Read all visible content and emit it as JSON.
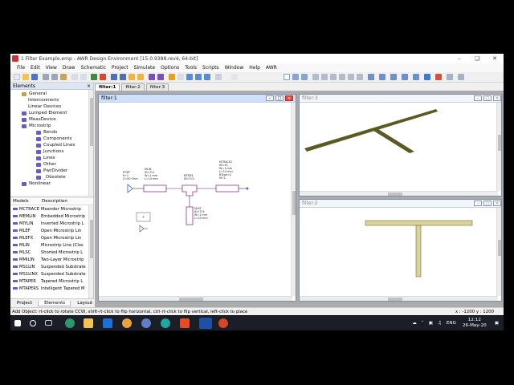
{
  "window": {
    "title": "1 Filter Example.emp - AWR Design Environment [15.0.9388.rev4, 64-bit]"
  },
  "menu": [
    "File",
    "Edit",
    "View",
    "Draw",
    "Schematic",
    "Project",
    "Simulate",
    "Options",
    "Tools",
    "Scripts",
    "Window",
    "Help",
    "AWR"
  ],
  "elements_panel": {
    "title": "Elements",
    "tree": [
      {
        "label": "General",
        "level": 1
      },
      {
        "label": "Interconnects",
        "level": 1
      },
      {
        "label": "Linear Devices",
        "level": 1
      },
      {
        "label": "Lumped Element",
        "level": 1
      },
      {
        "label": "MeasDevice",
        "level": 1
      },
      {
        "label": "Microstrip",
        "level": 1
      },
      {
        "label": "Bends",
        "level": 2
      },
      {
        "label": "Components",
        "level": 2
      },
      {
        "label": "Coupled Lines",
        "level": 2
      },
      {
        "label": "Junctions",
        "level": 2
      },
      {
        "label": "Lines",
        "level": 2
      },
      {
        "label": "Other",
        "level": 2
      },
      {
        "label": "PwrDivider",
        "level": 2
      },
      {
        "label": "_Obsolete",
        "level": 2
      },
      {
        "label": "Nonlinear",
        "level": 1
      }
    ],
    "columns": [
      "Models",
      "Description"
    ],
    "models": [
      {
        "name": "MCTRACE",
        "desc": "Meander Microstrip"
      },
      {
        "name": "MEMLIN",
        "desc": "Embedded Microstrip"
      },
      {
        "name": "MIYLIN",
        "desc": "Inverted Microstrip L"
      },
      {
        "name": "MLEF",
        "desc": "Open Microstrip Lin"
      },
      {
        "name": "MLEFX",
        "desc": "Open Microstrip Lin"
      },
      {
        "name": "MLIN",
        "desc": "Microstrip Line (Clos"
      },
      {
        "name": "MLSC",
        "desc": "Shorted Microstrip L"
      },
      {
        "name": "MMILIN",
        "desc": "Two-Layer Microstrip"
      },
      {
        "name": "MS1LIN",
        "desc": "Suspended Substrate"
      },
      {
        "name": "MS1LINX",
        "desc": "Suspended Substrate"
      },
      {
        "name": "MTAPER",
        "desc": "Tapered Microstrip L"
      },
      {
        "name": "MTAPERS",
        "desc": "Intelligent Tapered M"
      }
    ],
    "tabs": [
      "Project",
      "Elements",
      "Layout"
    ],
    "active_tab": "Elements"
  },
  "doc_tabs": [
    "filter:1",
    "filter:2",
    "filter:3"
  ],
  "windows": {
    "schematic": {
      "title": "filter:1",
      "port": [
        "PORT",
        "P=1",
        "Z=50 Ohm"
      ],
      "mlin1": [
        "MLIN",
        "ID=TL1",
        "W=1 mm",
        "L=10 mm"
      ],
      "mtee": [
        "MTEE$",
        "ID=TL3"
      ],
      "mtrace": [
        "MTRACE2",
        "ID=X1",
        "W=1 mm",
        "L=10 mm",
        "BType=2",
        "M=1"
      ],
      "mlin2": [
        "MLEF",
        "ID=TL3",
        "W=1 mm",
        "L=10 mm"
      ]
    },
    "view3d": {
      "title": "filter:3"
    },
    "layout": {
      "title": "filter:2"
    }
  },
  "status": {
    "hint": "Add Object:  rt-click to rotate CCW, shift-rt-click to flip horizontal, ctrl-rt-click to flip vertical, left-click to place",
    "coords": "x : -1200    y : 1200"
  },
  "taskbar": {
    "lang": "ENG",
    "time": "12:12",
    "date": "26-May-20"
  },
  "colors": {
    "trace3d": "#5c5a22",
    "trace2d": "#d9d39a",
    "component": "#9b2a8c",
    "accent": "#1e6fd9"
  }
}
